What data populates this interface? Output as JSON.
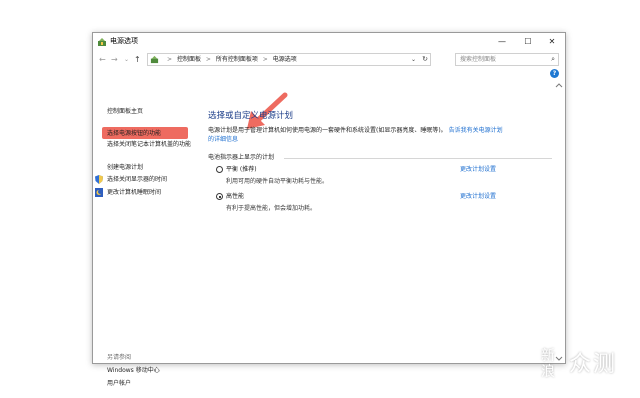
{
  "window": {
    "title": "电源选项",
    "controls": {
      "minimize": "—",
      "maximize": "☐",
      "close": "✕"
    },
    "icon": "power-options-icon"
  },
  "address_bar": {
    "back": "←",
    "forward": "→",
    "recent": "⌄",
    "up": "↑",
    "breadcrumbs": [
      "控制面板",
      "所有控制面板项",
      "电源选项"
    ],
    "separator": ">",
    "dropdown": "⌄",
    "refresh": "↻",
    "search_placeholder": "搜索控制面板",
    "search_icon": "⌕"
  },
  "help": {
    "label": "?"
  },
  "sidebar": {
    "home": "控制面板主页",
    "highlighted_link": "选择电源按钮的功能",
    "lid_link": "选择关闭笔记本计算机盖的功能",
    "create_plan": "创建电源计划",
    "display_off": "选择关闭显示器的时间",
    "sleep_time": "更改计算机睡眠时间",
    "see_also": "另请参阅",
    "mobility_center": "Windows 移动中心",
    "user_accounts": "用户帐户"
  },
  "main": {
    "title": "选择或自定义电源计划",
    "description": "电源计划是用于管理计算机如何使用电源的一套硬件和系统设置(如显示器亮度、睡眠等)。",
    "description_link": "告诉我有关电源计划的详细信息",
    "section_label": "电池指示器上显示的计划",
    "plans": [
      {
        "name": "平衡 (推荐)",
        "desc": "利用可用的硬件自动平衡功耗与性能。",
        "link": "更改计划设置",
        "selected": false
      },
      {
        "name": "高性能",
        "desc": "有利于提高性能，但会增加功耗。",
        "link": "更改计划设置",
        "selected": true
      }
    ]
  },
  "watermark": {
    "line1": "新",
    "line2": "浪",
    "main": "众测"
  },
  "colors": {
    "highlight": "#ee6b60",
    "arrow": "#ee6b60",
    "link": "#1e6fd0",
    "title": "#1e3f8a"
  }
}
